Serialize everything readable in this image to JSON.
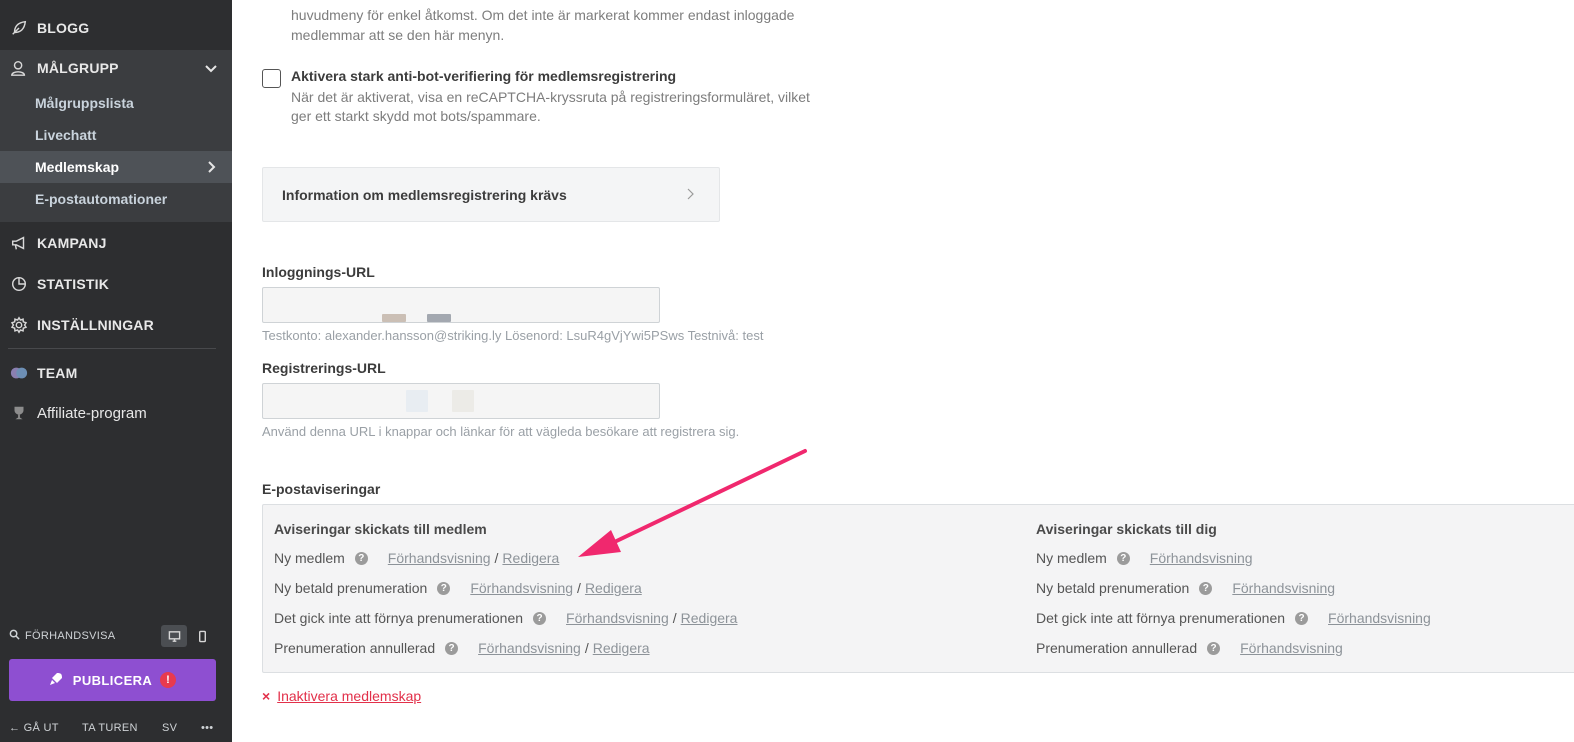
{
  "sidebar": {
    "items": [
      {
        "label": "BLOGG",
        "icon": "feather-icon"
      },
      {
        "label": "MÅLGRUPP",
        "icon": "users-icon"
      },
      {
        "label": "KAMPANJ",
        "icon": "megaphone-icon"
      },
      {
        "label": "STATISTIK",
        "icon": "pie-chart-icon"
      },
      {
        "label": "INSTÄLLNINGAR",
        "icon": "gear-icon"
      },
      {
        "label": "TEAM",
        "icon": "team-avatar-icon"
      },
      {
        "label": "Affiliate-program",
        "icon": "trophy-icon"
      }
    ],
    "subitems": [
      {
        "label": "Målgruppslista"
      },
      {
        "label": "Livechatt"
      },
      {
        "label": "Medlemskap"
      },
      {
        "label": "E-postautomationer"
      }
    ],
    "preview_label": "FÖRHANDSVISA",
    "publish_label": "PUBLICERA",
    "publish_alert": "!",
    "footer": {
      "exit": "GÅ UT",
      "tour": "TA TUREN",
      "lang": "SV",
      "more": "•••"
    }
  },
  "main": {
    "menu_desc_line1": "huvudmeny för enkel åtkomst. Om det inte är markerat kommer endast inloggade",
    "menu_desc_line2": "medlemmar att se den här menyn.",
    "antibot_title": "Aktivera stark anti-bot-verifiering för medlemsregistrering",
    "antibot_desc_line1": "När det är aktiverat, visa en reCAPTCHA-kryssruta på registreringsformuläret, vilket",
    "antibot_desc_line2": "ger ett starkt skydd mot bots/spammare.",
    "accordion_label": "Information om medlemsregistrering krävs",
    "login_url_label": "Inloggnings-URL",
    "login_hint": "Testkonto: alexander.hansson@striking.ly   Lösenord: LsuR4gVjYwi5PSws   Testnivå: test",
    "register_url_label": "Registrerings-URL",
    "register_hint": "Använd denna URL i knappar och länkar för att vägleda besökare att registrera sig.",
    "email_notifications_label": "E-postaviseringar",
    "member_col_title": "Aviseringar skickats till medlem",
    "you_col_title": "Aviseringar skickats till dig",
    "notifications": [
      {
        "label": "Ny medlem"
      },
      {
        "label": "Ny betald prenumeration"
      },
      {
        "label": "Det gick inte att förnya prenumerationen"
      },
      {
        "label": "Prenumeration annullerad"
      }
    ],
    "preview_link": "Förhandsvisning",
    "edit_link": "Redigera",
    "separator": "/",
    "help_glyph": "?",
    "deactivate_icon": "×",
    "deactivate_label": "Inaktivera medlemskap"
  },
  "colors": {
    "sidebar_bg": "#2d2e30",
    "publish": "#8e4fd1",
    "annotation_arrow": "#f0286e",
    "danger": "#e2304a"
  }
}
